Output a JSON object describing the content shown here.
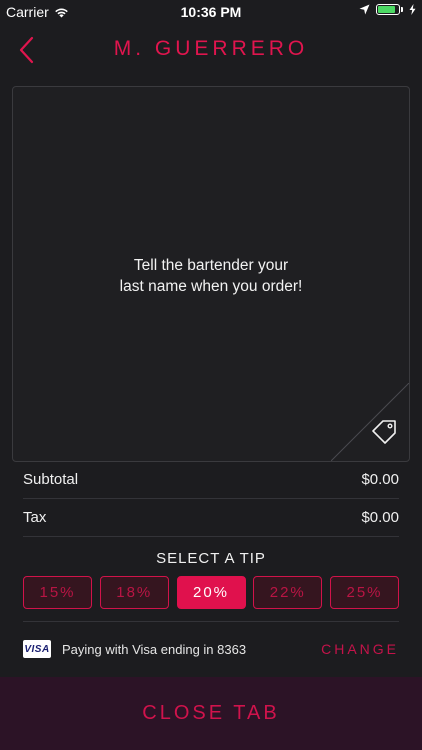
{
  "status_bar": {
    "carrier": "Carrier",
    "time": "10:36 PM"
  },
  "header": {
    "title": "M. GUERRERO"
  },
  "message": {
    "line1": "Tell the bartender your",
    "line2": "last name when you order!"
  },
  "summary": {
    "subtotal_label": "Subtotal",
    "subtotal_value": "$0.00",
    "tax_label": "Tax",
    "tax_value": "$0.00"
  },
  "tip": {
    "heading": "SELECT A TIP",
    "options": [
      "15%",
      "18%",
      "20%",
      "22%",
      "25%"
    ],
    "selected": "20%"
  },
  "payment": {
    "card_brand": "VISA",
    "text": "Paying with Visa ending in 8363",
    "change_label": "CHANGE"
  },
  "footer": {
    "close_label": "CLOSE TAB"
  },
  "colors": {
    "accent": "#e0114d",
    "background": "#1c1c1f",
    "footer_bg": "#2c1326"
  }
}
